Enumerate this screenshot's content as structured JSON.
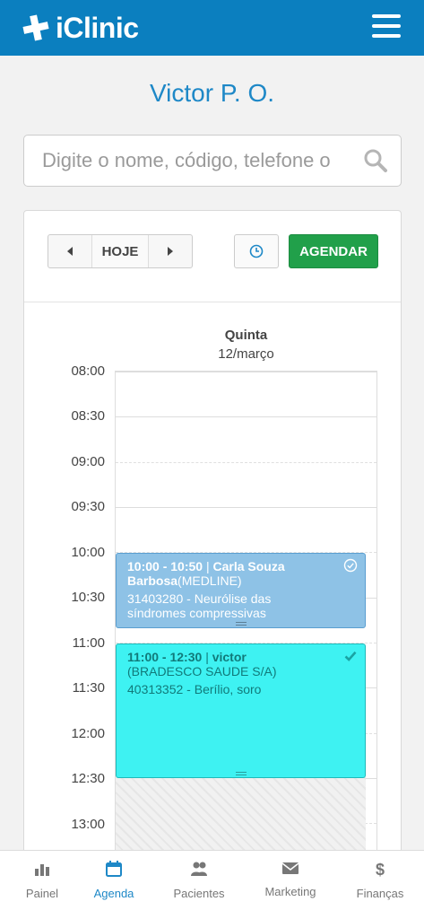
{
  "header": {
    "brand": "iClinic",
    "brand_color": "#0b7fbf",
    "menu_icon": "hamburger-icon"
  },
  "doctor": {
    "name": "Victor P. O."
  },
  "search": {
    "placeholder": "Digite o nome, código, telefone o",
    "icon": "search-icon"
  },
  "toolbar": {
    "prev_icon": "chevron-left-icon",
    "today_label": "HOJE",
    "next_icon": "chevron-right-icon",
    "clock_icon": "clock-icon",
    "schedule_label": "AGENDAR",
    "schedule_color": "#21a04a"
  },
  "calendar": {
    "day_name": "Quinta",
    "day_date": "12/março",
    "times": [
      "08:00",
      "08:30",
      "09:00",
      "09:30",
      "10:00",
      "10:30",
      "11:00",
      "11:30",
      "12:00",
      "12:30",
      "13:00"
    ],
    "events": [
      {
        "time": "10:00 - 10:50",
        "separator": "|",
        "patient_first": "Carla Souza",
        "patient_last": "Barbosa",
        "insurance": "(MEDLINE)",
        "procedure_line1": "31403280 - Neurólise das",
        "procedure_line2": "síndromes compressivas",
        "status_icon": "check-circle-icon",
        "color": "#8ec2e6"
      },
      {
        "time": "11:00 - 12:30",
        "separator": "|",
        "patient_first": "victor",
        "insurance": "(BRADESCO SAUDE S/A)",
        "procedure_line1": "40313352 - Berílio, soro",
        "status_icon": "check-icon",
        "color": "#3ef2f2"
      }
    ]
  },
  "bottom_nav": [
    {
      "label": "Painel",
      "icon": "bar-chart-icon"
    },
    {
      "label": "Agenda",
      "icon": "calendar-icon",
      "active": true
    },
    {
      "label": "Pacientes",
      "icon": "users-icon"
    },
    {
      "label": "Marketing",
      "icon": "envelope-icon"
    },
    {
      "label": "Finanças",
      "icon": "dollar-icon"
    }
  ]
}
